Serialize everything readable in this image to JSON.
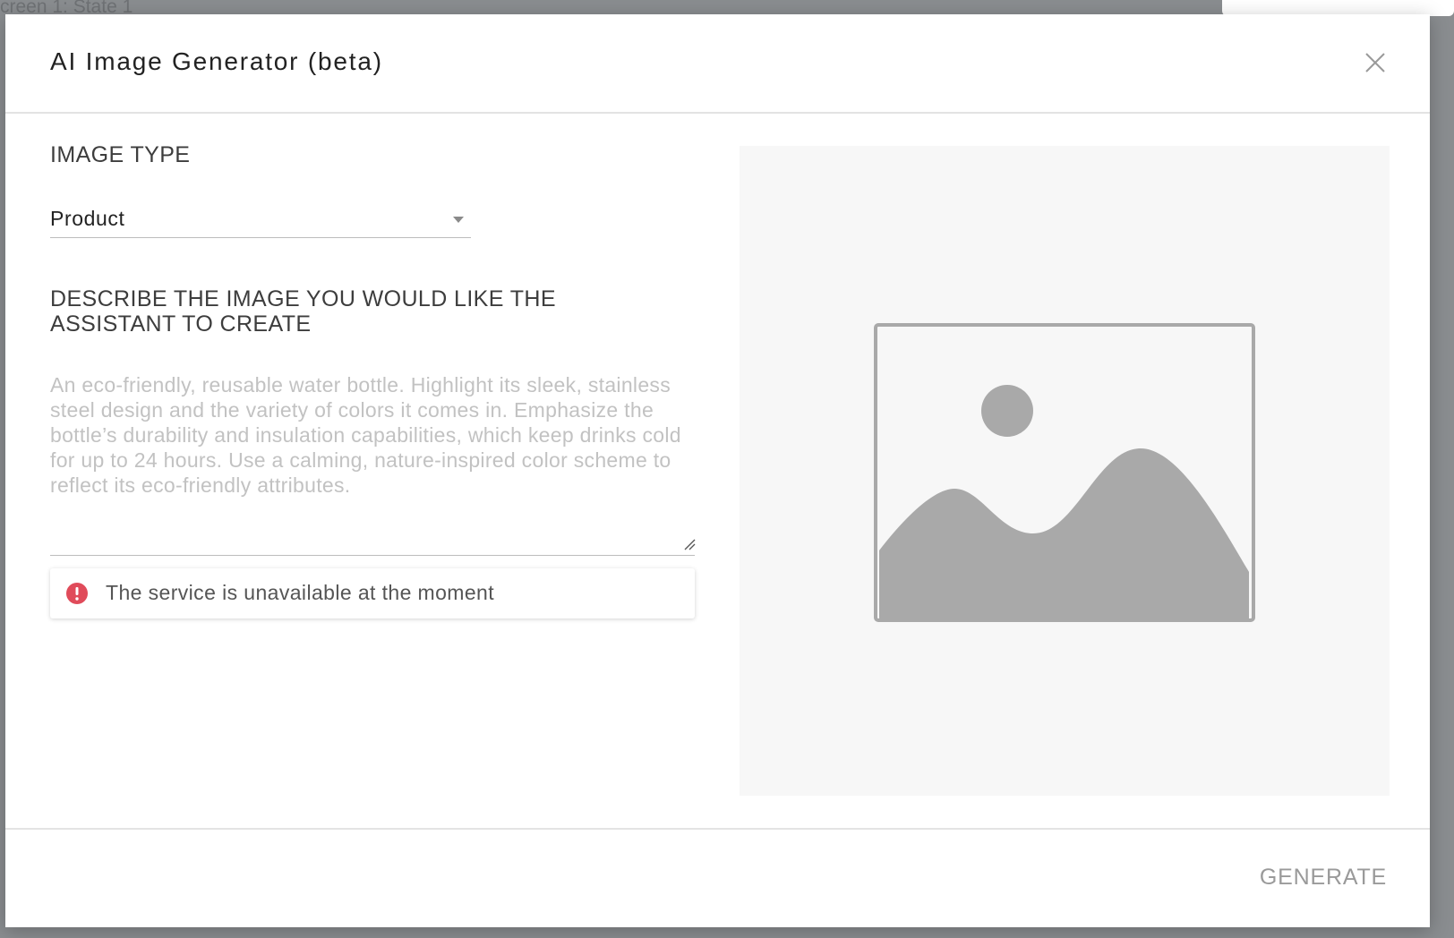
{
  "backdrop": {
    "label": "creen 1: State 1"
  },
  "modal": {
    "title": "AI Image Generator (beta)",
    "close_icon": "close-icon"
  },
  "form": {
    "image_type": {
      "label": "IMAGE TYPE",
      "selected_value": "Product",
      "icon": "chevron-down-icon"
    },
    "description": {
      "label": "DESCRIBE THE IMAGE YOU WOULD LIKE THE ASSISTANT TO CREATE",
      "value": "",
      "placeholder": "An eco-friendly, reusable water bottle. Highlight its sleek, stainless steel design and the variety of colors it comes in. Emphasize the bottle’s durability and insulation capabilities, which keep drinks cold for up to 24 hours. Use a calming, nature-inspired color scheme to reflect its eco-friendly attributes.",
      "resize_icon": "resize-handle-icon"
    },
    "error": {
      "icon": "error-icon",
      "message": "The service is unavailable at the moment"
    }
  },
  "preview": {
    "icon": "image-placeholder-icon"
  },
  "footer": {
    "generate_label": "GENERATE"
  },
  "colors": {
    "backdrop": "#8a8d90",
    "error": "#e04b5a",
    "placeholder_icon": "#a9a9a9",
    "preview_bg": "#f7f7f7",
    "disabled_text": "#9a9a9a"
  }
}
